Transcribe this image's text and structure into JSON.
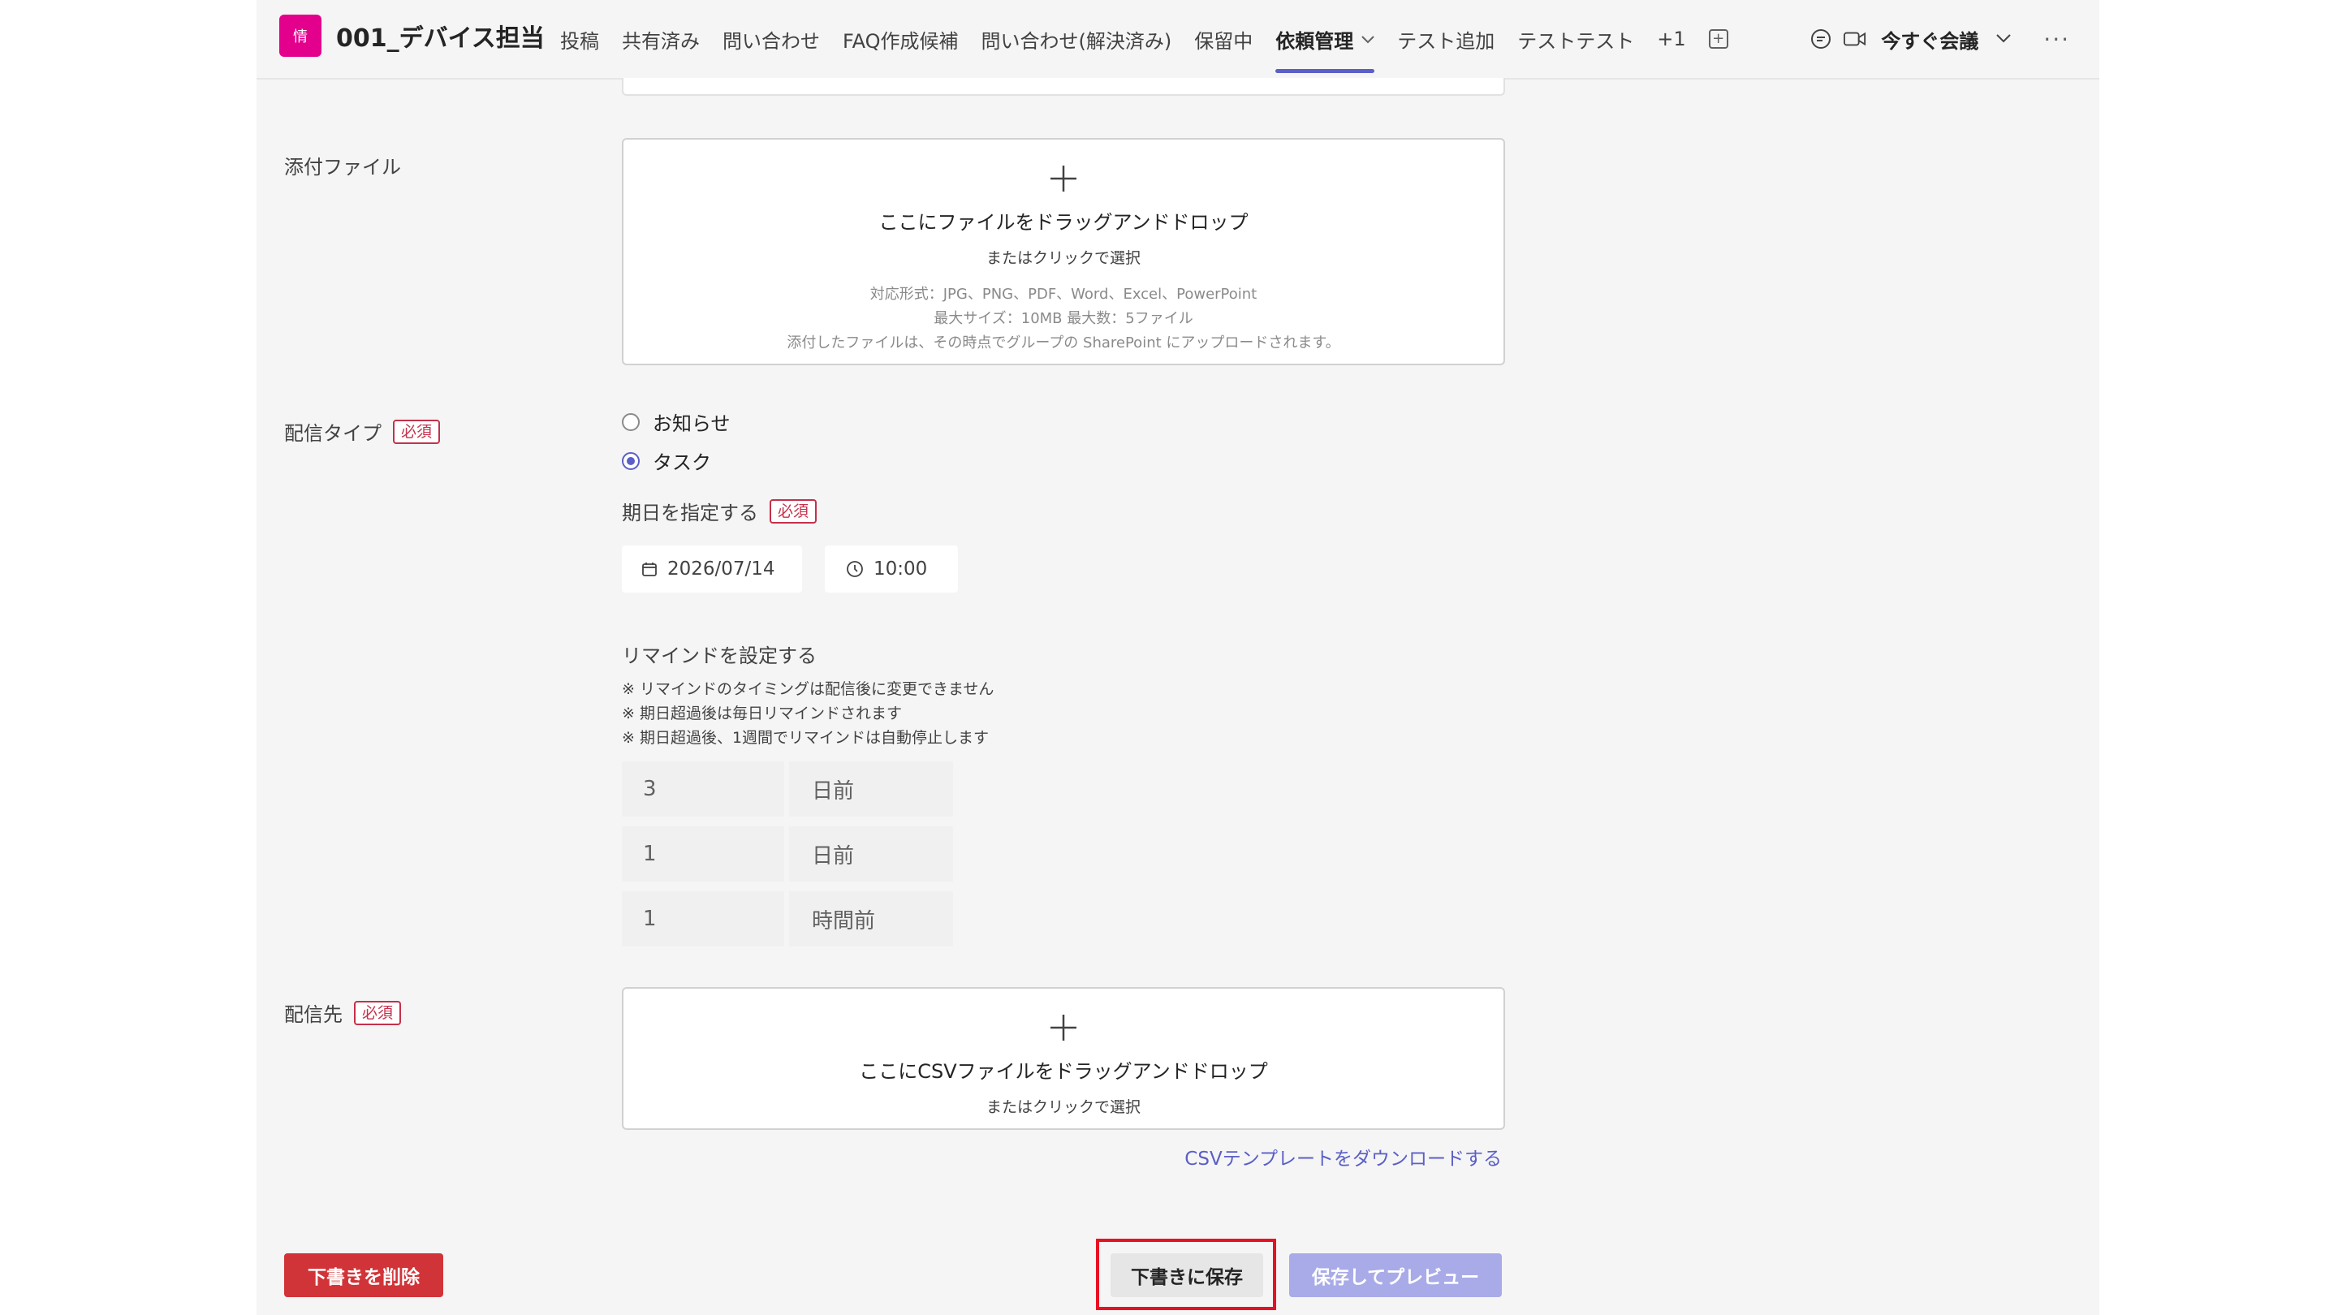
{
  "header": {
    "avatar_text": "情",
    "team_name": "001_デバイス担当",
    "tabs": [
      {
        "label": "投稿"
      },
      {
        "label": "共有済み"
      },
      {
        "label": "問い合わせ"
      },
      {
        "label": "FAQ作成候補"
      },
      {
        "label": "問い合わせ(解決済み)"
      },
      {
        "label": "保留中"
      },
      {
        "label": "依頼管理"
      },
      {
        "label": "テスト追加"
      },
      {
        "label": "テストテスト"
      },
      {
        "label": "+1"
      }
    ],
    "active_tab": "依頼管理",
    "meet_label": "今すぐ会議",
    "more_label": "···"
  },
  "form": {
    "attachment": {
      "label": "添付ファイル",
      "drop_text": "ここにファイルをドラッグアンドドロップ",
      "click_text": "またはクリックで選択",
      "formats": "対応形式：JPG、PNG、PDF、Word、Excel、PowerPoint",
      "limits": "最大サイズ：10MB 最大数：5ファイル",
      "upload_note": "添付したファイルは、その時点でグループの SharePoint にアップロードされます。"
    },
    "delivery_type": {
      "label": "配信タイプ",
      "required": "必須",
      "options": [
        {
          "label": "お知らせ",
          "selected": false
        },
        {
          "label": "タスク",
          "selected": true
        }
      ]
    },
    "due": {
      "label": "期日を指定する",
      "required": "必須",
      "date": "2026/07/14",
      "time": "10:00"
    },
    "reminder": {
      "label": "リマインドを設定する",
      "notes": [
        "※ リマインドのタイミングは配信後に変更できません",
        "※ 期日超過後は毎日リマインドされます",
        "※ 期日超過後、1週間でリマインドは自動停止します"
      ],
      "rows": [
        {
          "value": "3",
          "unit": "日前"
        },
        {
          "value": "1",
          "unit": "日前"
        },
        {
          "value": "1",
          "unit": "時間前"
        }
      ]
    },
    "recipients": {
      "label": "配信先",
      "required": "必須",
      "drop_text": "ここにCSVファイルをドラッグアンドドロップ",
      "click_text": "またはクリックで選択",
      "template_link": "CSVテンプレートをダウンロードする"
    }
  },
  "actions": {
    "delete_label": "下書きを削除",
    "draft_label": "下書きに保存",
    "preview_label": "保存してプレビュー"
  },
  "colors": {
    "accent": "#5b5fc7",
    "danger": "#d13438",
    "team": "#e3008c",
    "highlight": "#e81123"
  }
}
